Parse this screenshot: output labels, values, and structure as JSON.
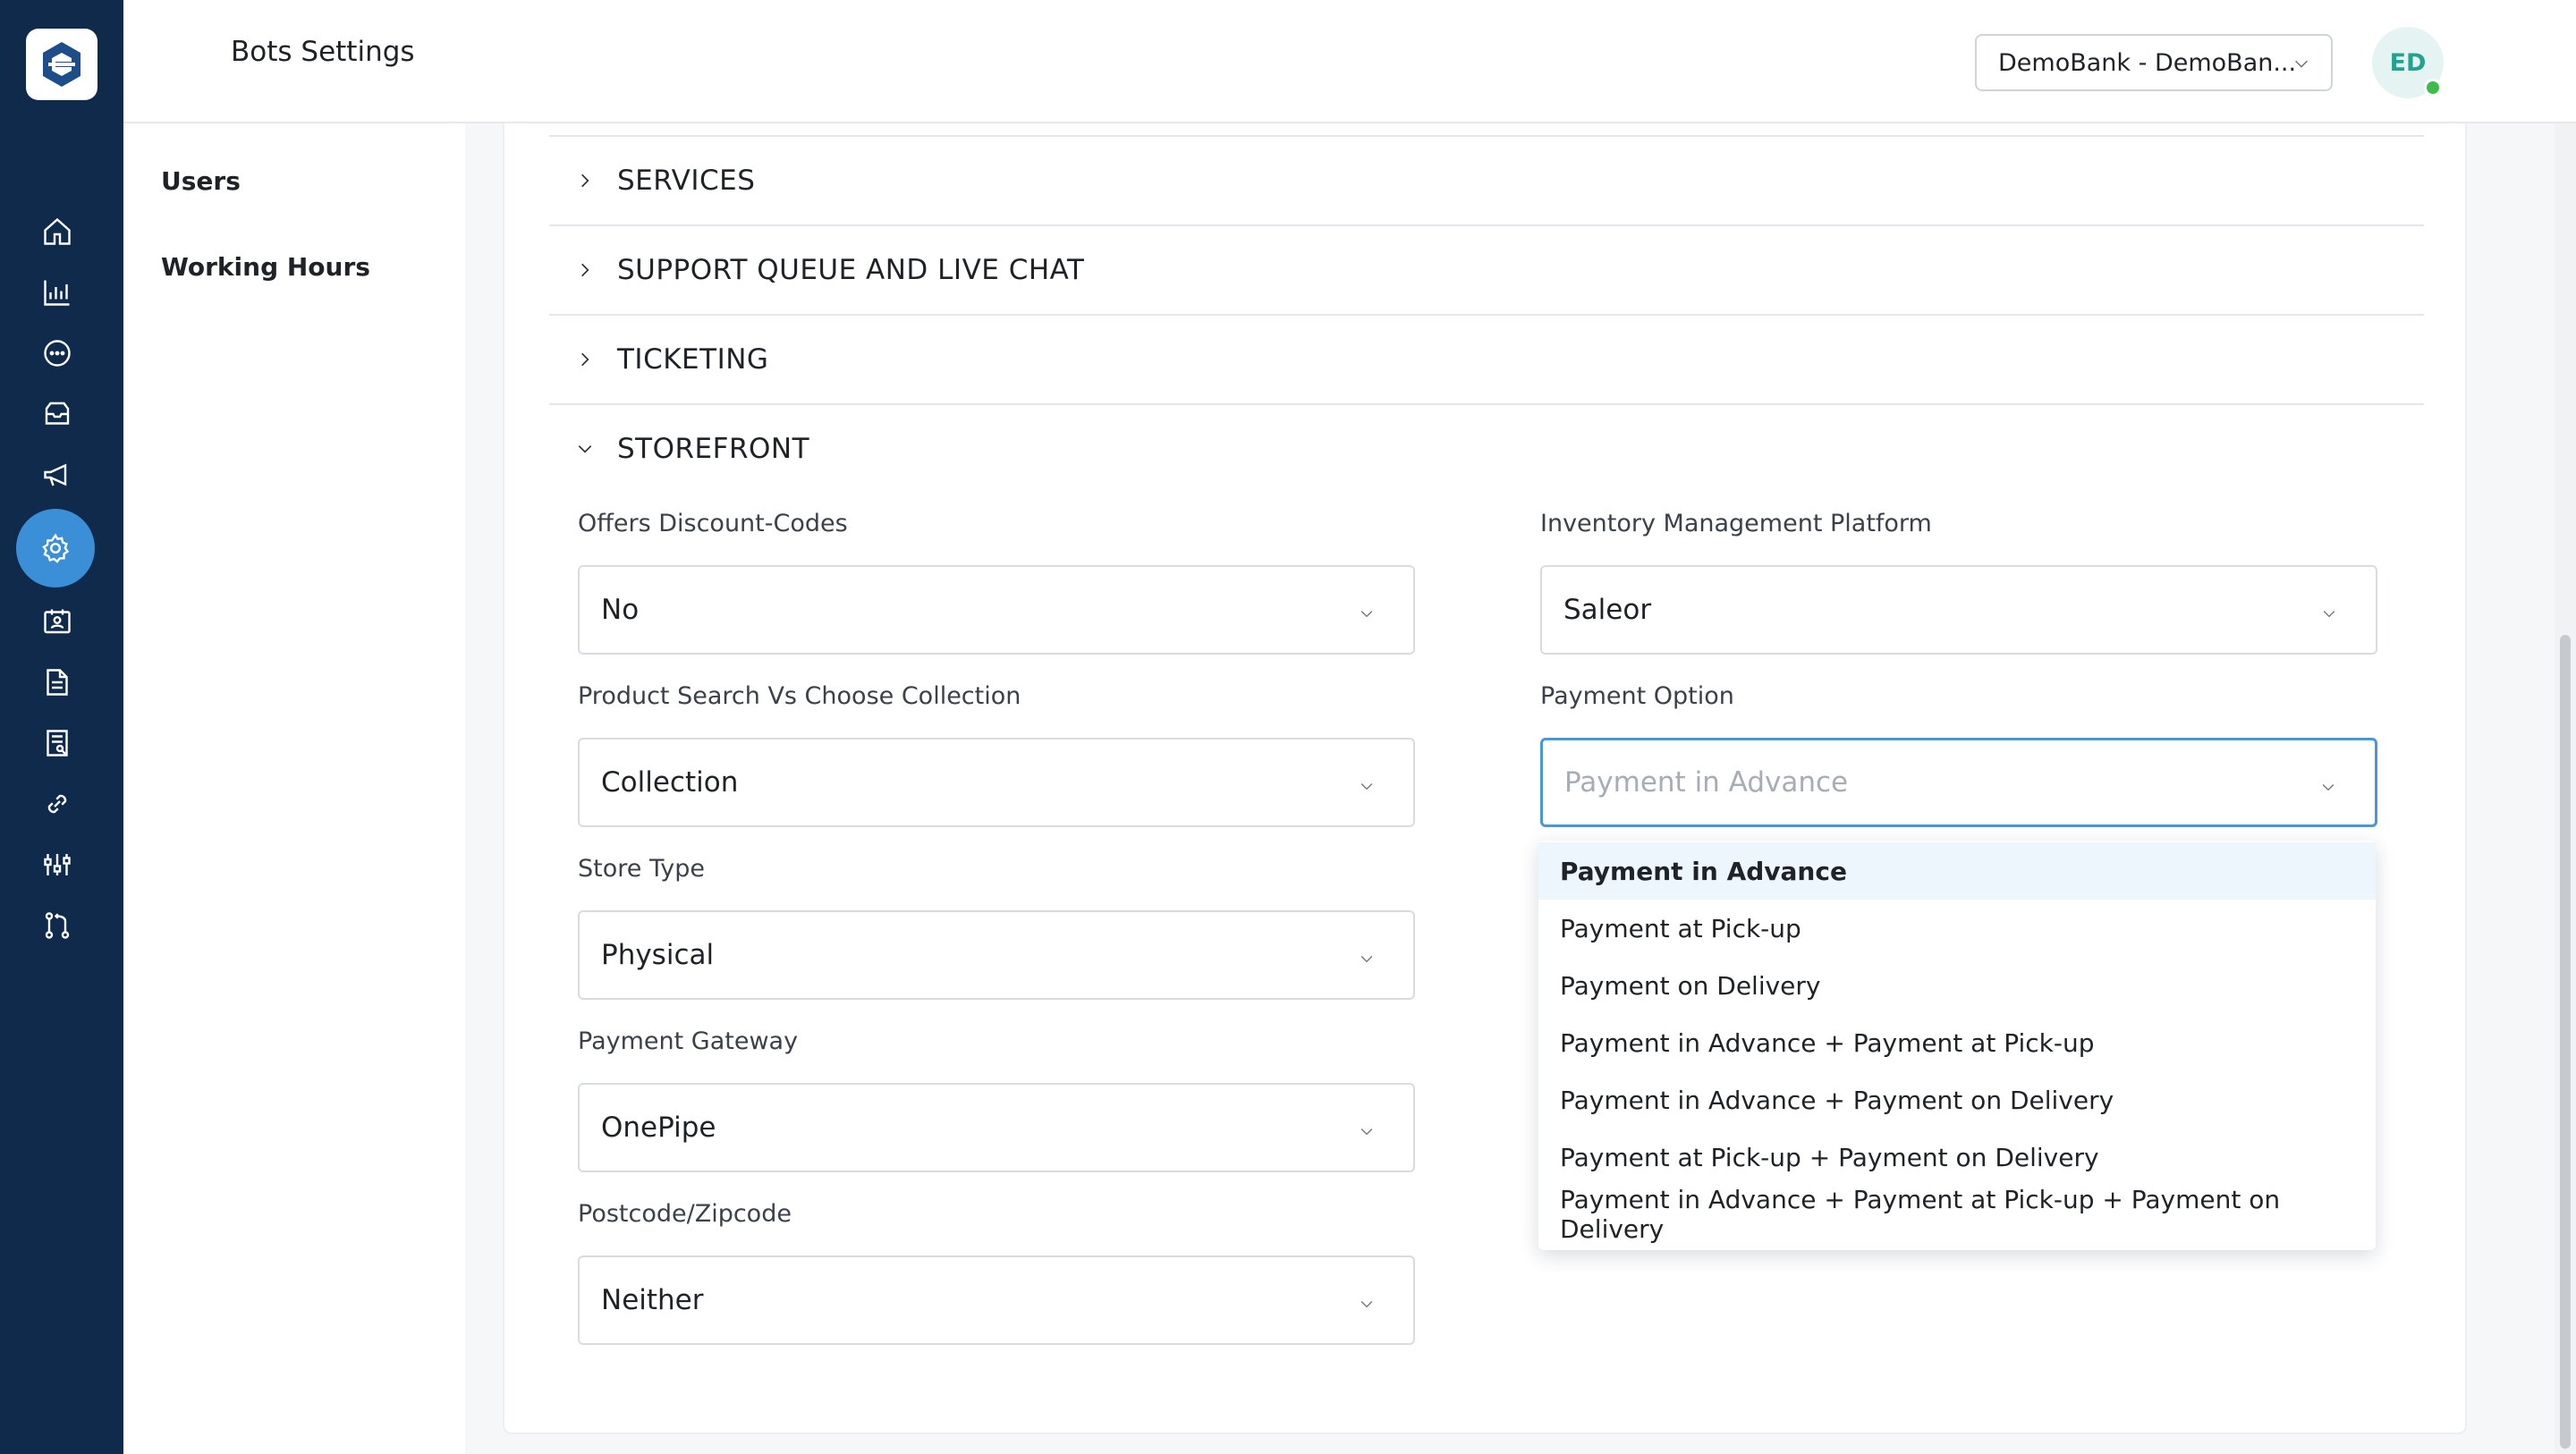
{
  "header": {
    "title": "Bots Settings",
    "org_select_value": "DemoBank - DemoBan...",
    "avatar_initials": "ED"
  },
  "sidebar": {
    "items": [
      {
        "label": "Users"
      },
      {
        "label": "Working Hours"
      }
    ]
  },
  "rail": {
    "icons": [
      "home-icon",
      "analytics-icon",
      "chat-icon",
      "inbox-icon",
      "megaphone-icon",
      "settings-icon",
      "contacts-icon",
      "document-icon",
      "report-icon",
      "link-icon",
      "sliders-icon",
      "git-branch-icon"
    ],
    "active": "settings-icon"
  },
  "sections": {
    "services": "SERVICES",
    "support": "SUPPORT QUEUE AND LIVE CHAT",
    "ticketing": "TICKETING",
    "storefront": "STOREFRONT"
  },
  "storefront": {
    "offers_discount": {
      "label": "Offers Discount-Codes",
      "value": "No"
    },
    "inventory_platform": {
      "label": "Inventory Management Platform",
      "value": "Saleor"
    },
    "product_search": {
      "label": "Product Search Vs Choose Collection",
      "value": "Collection"
    },
    "payment_option": {
      "label": "Payment Option",
      "placeholder": "Payment in Advance"
    },
    "store_type": {
      "label": "Store Type",
      "value": "Physical"
    },
    "payment_gateway": {
      "label": "Payment Gateway",
      "value": "OnePipe"
    },
    "postcode": {
      "label": "Postcode/Zipcode",
      "value": "Neither"
    }
  },
  "payment_options": [
    "Payment in Advance",
    "Payment at Pick-up",
    "Payment on Delivery",
    "Payment in Advance + Payment at Pick-up",
    "Payment in Advance + Payment on Delivery",
    "Payment at Pick-up + Payment on Delivery",
    "Payment in Advance + Payment at Pick-up + Payment on Delivery"
  ],
  "colors": {
    "rail_bg": "#0f2a4a",
    "accent": "#3a8fd6",
    "avatar_text": "#21a38f",
    "status_online": "#3bbd4a"
  }
}
